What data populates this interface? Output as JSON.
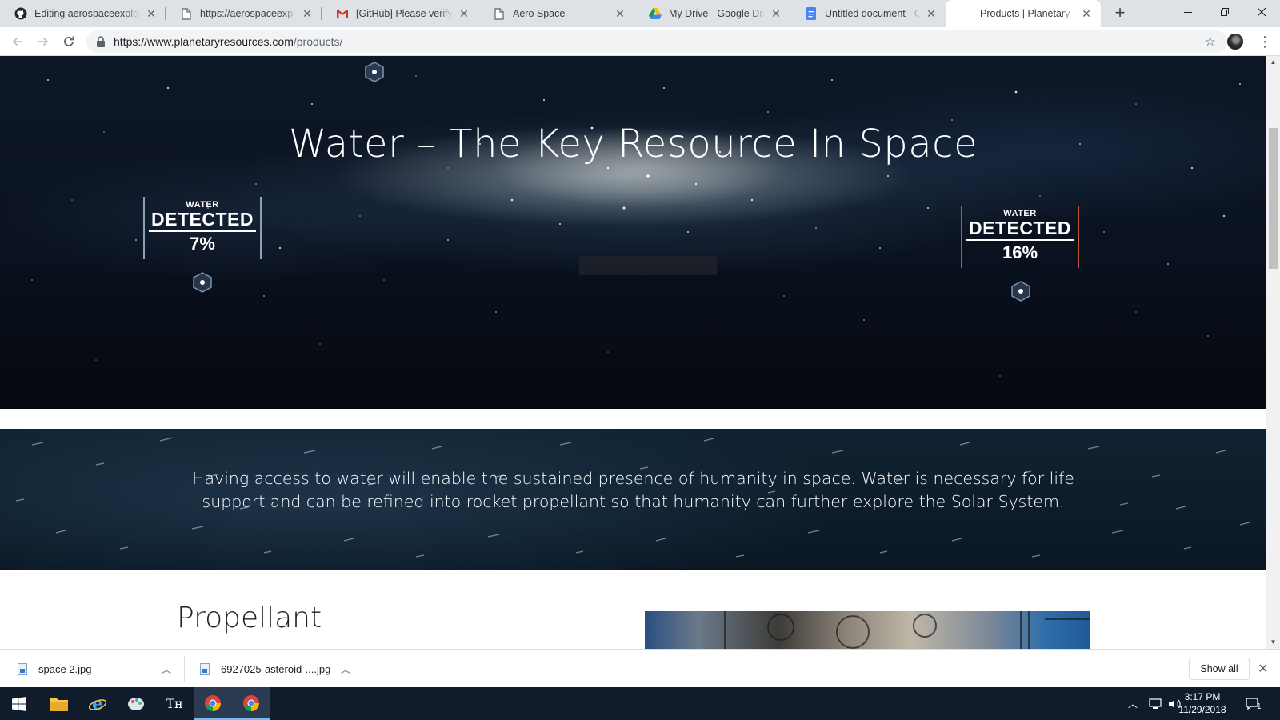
{
  "browser": {
    "tabs": [
      {
        "title": "Editing aerospaceexplorer",
        "icon": "github-icon"
      },
      {
        "title": "https://aerospaceexplorer",
        "icon": "page-icon"
      },
      {
        "title": "[GitHub] Please verify your",
        "icon": "gmail-icon"
      },
      {
        "title": "Aero Space",
        "icon": "page-icon"
      },
      {
        "title": "My Drive - Google Drive",
        "icon": "google-drive-icon"
      },
      {
        "title": "Untitled document - Goo",
        "icon": "google-docs-icon"
      },
      {
        "title": "Products | Planetary Reso",
        "icon": "planetary-resources-icon",
        "active": true
      }
    ],
    "url_host": "https://www.planetaryresources.com",
    "url_path": "/products/"
  },
  "hero": {
    "title": "Water – The Key Resource In Space",
    "badge_left": {
      "label_top": "WATER",
      "label_main": "DETECTED",
      "value": "7%",
      "accent": "#9aa9bb"
    },
    "badge_right": {
      "label_top": "WATER",
      "label_main": "DETECTED",
      "value": "16%",
      "accent": "#c0503a"
    }
  },
  "water_band": {
    "text": "Having access to water will enable the sustained presence of humanity in space. Water is necessary for life support and can be refined into rocket propellant so that humanity can further explore the Solar System."
  },
  "section": {
    "title": "Propellant"
  },
  "downloads": {
    "items": [
      {
        "name": "space 2.jpg"
      },
      {
        "name": "6927025-asteroid-....jpg"
      }
    ],
    "show_all": "Show all"
  },
  "taskbar": {
    "time": "3:17 PM",
    "date": "11/29/2018",
    "notifications": "1"
  },
  "colors": {
    "accent_blue": "#76b9ed",
    "taskbar": "#101c2c"
  }
}
